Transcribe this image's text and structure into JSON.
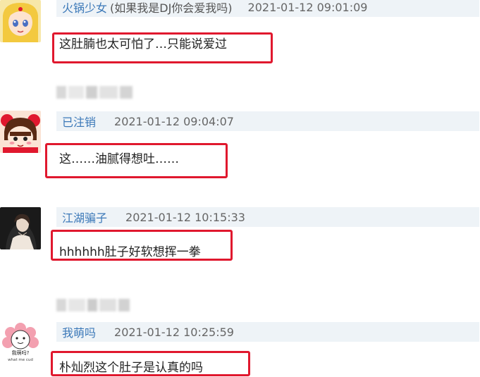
{
  "comments": [
    {
      "username": "火锅少女",
      "suffix": "(如果我是DJ你会爱我吗)",
      "timestamp": "2021-01-12 09:01:09",
      "text": "这肚腩也太可怕了…只能说爱过",
      "avatar_icon": "anime-girl-avatar-icon"
    },
    {
      "username": "已注销",
      "suffix": "",
      "timestamp": "2021-01-12 09:04:07",
      "text": "这……油腻得想吐……",
      "avatar_icon": "cartoon-character-avatar-icon"
    },
    {
      "username": "江湖骗子",
      "suffix": "",
      "timestamp": "2021-01-12 10:15:33",
      "text": "hhhhhh肚子好软想挥一拳",
      "avatar_icon": "photo-woman-avatar-icon"
    },
    {
      "username": "我萌吗",
      "suffix": "",
      "timestamp": "2021-01-12 10:25:59",
      "text": "朴灿烈这个肚子是认真的吗",
      "avatar_icon": "flower-meme-avatar-icon",
      "avatar_caption_line1": "我萌吗?",
      "avatar_caption_line2": "what me cud"
    }
  ],
  "colors": {
    "username": "#3b78b8",
    "meta_bar_bg": "#eef3f7",
    "highlight_border": "#e0182e"
  }
}
